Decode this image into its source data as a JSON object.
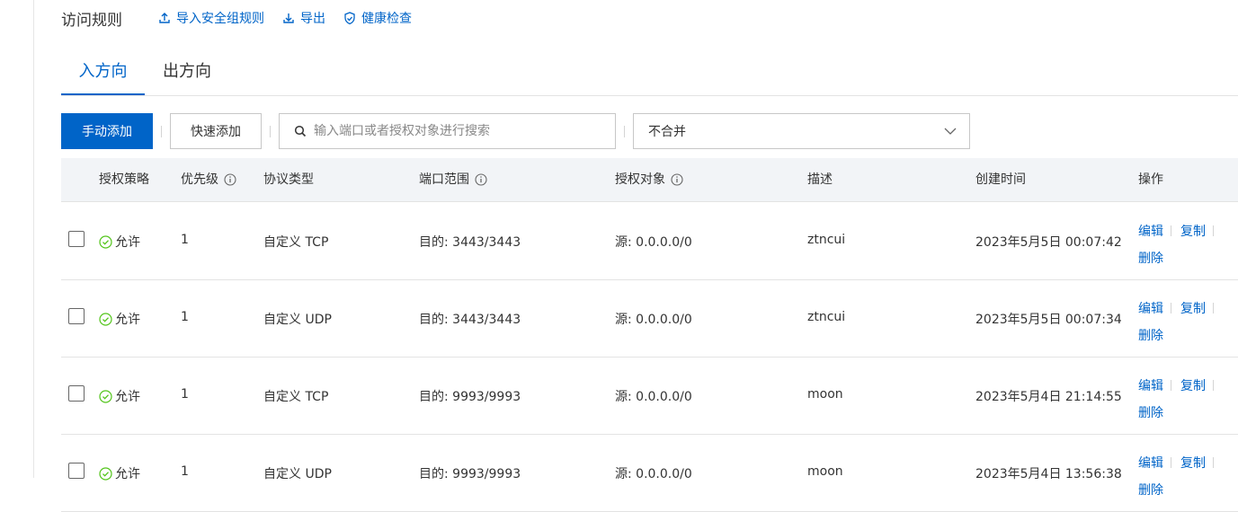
{
  "header": {
    "title": "访问规则",
    "import_label": "导入安全组规则",
    "export_label": "导出",
    "health_label": "健康检查"
  },
  "tabs": [
    {
      "label": "入方向",
      "active": true
    },
    {
      "label": "出方向",
      "active": false
    }
  ],
  "toolbar": {
    "manual_add": "手动添加",
    "quick_add": "快速添加",
    "search_placeholder": "输入端口或者授权对象进行搜索",
    "merge_select": "不合并"
  },
  "table": {
    "columns": [
      "授权策略",
      "优先级",
      "协议类型",
      "端口范围",
      "授权对象",
      "描述",
      "创建时间",
      "操作"
    ],
    "rows": [
      {
        "policy": "允许",
        "priority": "1",
        "protocol": "自定义 TCP",
        "port": "目的: 3443/3443",
        "source": "源: 0.0.0.0/0",
        "desc": "ztncui",
        "created": "2023年5月5日 00:07:42"
      },
      {
        "policy": "允许",
        "priority": "1",
        "protocol": "自定义 UDP",
        "port": "目的: 3443/3443",
        "source": "源: 0.0.0.0/0",
        "desc": "ztncui",
        "created": "2023年5月5日 00:07:34"
      },
      {
        "policy": "允许",
        "priority": "1",
        "protocol": "自定义 TCP",
        "port": "目的: 9993/9993",
        "source": "源: 0.0.0.0/0",
        "desc": "moon",
        "created": "2023年5月4日 21:14:55"
      },
      {
        "policy": "允许",
        "priority": "1",
        "protocol": "自定义 UDP",
        "port": "目的: 9993/9993",
        "source": "源: 0.0.0.0/0",
        "desc": "moon",
        "created": "2023年5月4日 13:56:38"
      }
    ],
    "actions": {
      "edit": "编辑",
      "copy": "复制",
      "delete": "删除"
    }
  },
  "colors": {
    "primary": "#0064c8",
    "allow_green": "#52c41a",
    "header_bg": "#f2f4f7"
  }
}
